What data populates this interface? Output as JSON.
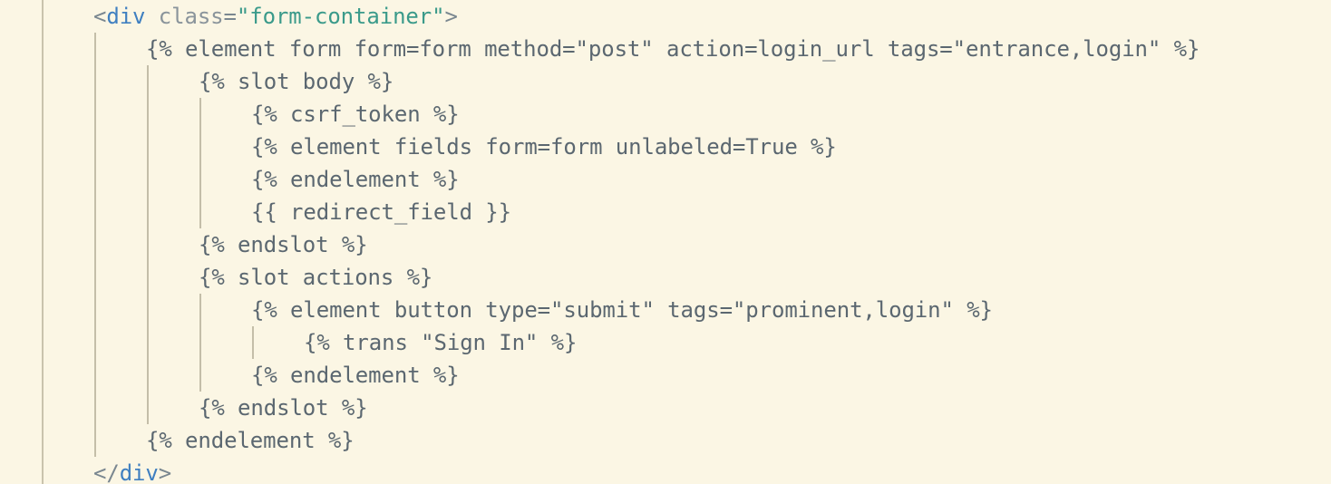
{
  "editor": {
    "lines": [
      {
        "indent": 0,
        "tokens": [
          {
            "kind": "bracket",
            "text": "<"
          },
          {
            "kind": "tag",
            "text": "div"
          },
          {
            "kind": "code",
            "text": " "
          },
          {
            "kind": "attr",
            "text": "class"
          },
          {
            "kind": "eq",
            "text": "="
          },
          {
            "kind": "str",
            "text": "\"form-container\""
          },
          {
            "kind": "bracket",
            "text": ">"
          }
        ]
      },
      {
        "indent": 1,
        "tokens": [
          {
            "kind": "code",
            "text": "{% element form form=form method=\"post\" action=login_url tags=\"entrance,login\" %}"
          }
        ]
      },
      {
        "indent": 2,
        "tokens": [
          {
            "kind": "code",
            "text": "{% slot body %}"
          }
        ]
      },
      {
        "indent": 3,
        "tokens": [
          {
            "kind": "code",
            "text": "{% csrf_token %}"
          }
        ]
      },
      {
        "indent": 3,
        "tokens": [
          {
            "kind": "code",
            "text": "{% element fields form=form unlabeled=True %}"
          }
        ]
      },
      {
        "indent": 3,
        "tokens": [
          {
            "kind": "code",
            "text": "{% endelement %}"
          }
        ]
      },
      {
        "indent": 3,
        "tokens": [
          {
            "kind": "code",
            "text": "{{ redirect_field }}"
          }
        ]
      },
      {
        "indent": 2,
        "tokens": [
          {
            "kind": "code",
            "text": "{% endslot %}"
          }
        ]
      },
      {
        "indent": 2,
        "tokens": [
          {
            "kind": "code",
            "text": "{% slot actions %}"
          }
        ]
      },
      {
        "indent": 3,
        "tokens": [
          {
            "kind": "code",
            "text": "{% element button type=\"submit\" tags=\"prominent,login\" %}"
          }
        ]
      },
      {
        "indent": 4,
        "tokens": [
          {
            "kind": "code",
            "text": "{% trans \"Sign In\" %}"
          }
        ]
      },
      {
        "indent": 3,
        "tokens": [
          {
            "kind": "code",
            "text": "{% endelement %}"
          }
        ]
      },
      {
        "indent": 2,
        "tokens": [
          {
            "kind": "code",
            "text": "{% endslot %}"
          }
        ]
      },
      {
        "indent": 1,
        "tokens": [
          {
            "kind": "code",
            "text": "{% endelement %}"
          }
        ]
      },
      {
        "indent": 0,
        "tokens": [
          {
            "kind": "bracket",
            "text": "</"
          },
          {
            "kind": "tag",
            "text": "div"
          },
          {
            "kind": "bracket",
            "text": ">"
          }
        ]
      }
    ]
  },
  "colors": {
    "background": "#fbf6e4",
    "tag": "#3f7fc0",
    "string": "#3a9a8a",
    "text": "#5b6770",
    "guide": "#c4bea9"
  }
}
